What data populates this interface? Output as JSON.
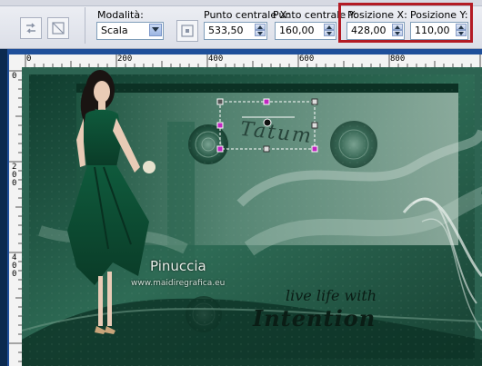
{
  "toolbar": {
    "mode_label": "Modalità:",
    "mode_value": "Scala",
    "center_x_label": "Punto centrale X:",
    "center_x_value": "533,50",
    "center_y_label": "Punto centrale Y:",
    "center_y_value": "160,00",
    "pos_x_label": "Posizione X:",
    "pos_x_value": "428,00",
    "pos_y_label": "Posizione Y:",
    "pos_y_value": "110,00"
  },
  "ruler": {
    "h_labels": [
      "0",
      "200",
      "400",
      "600",
      "800"
    ],
    "v_labels": [
      "0",
      "2 0 0",
      "4 0 0"
    ]
  },
  "canvas": {
    "watermark_name": "Pinuccia",
    "watermark_site": "www.maidiregrafica.eu",
    "text_line1": "live life with",
    "text_line2": "Intention",
    "selected_text": "Tatum"
  },
  "colors": {
    "highlight": "#b31b24",
    "window_frame": "#1f4f9a",
    "canvas_green": "#1e5a44"
  }
}
